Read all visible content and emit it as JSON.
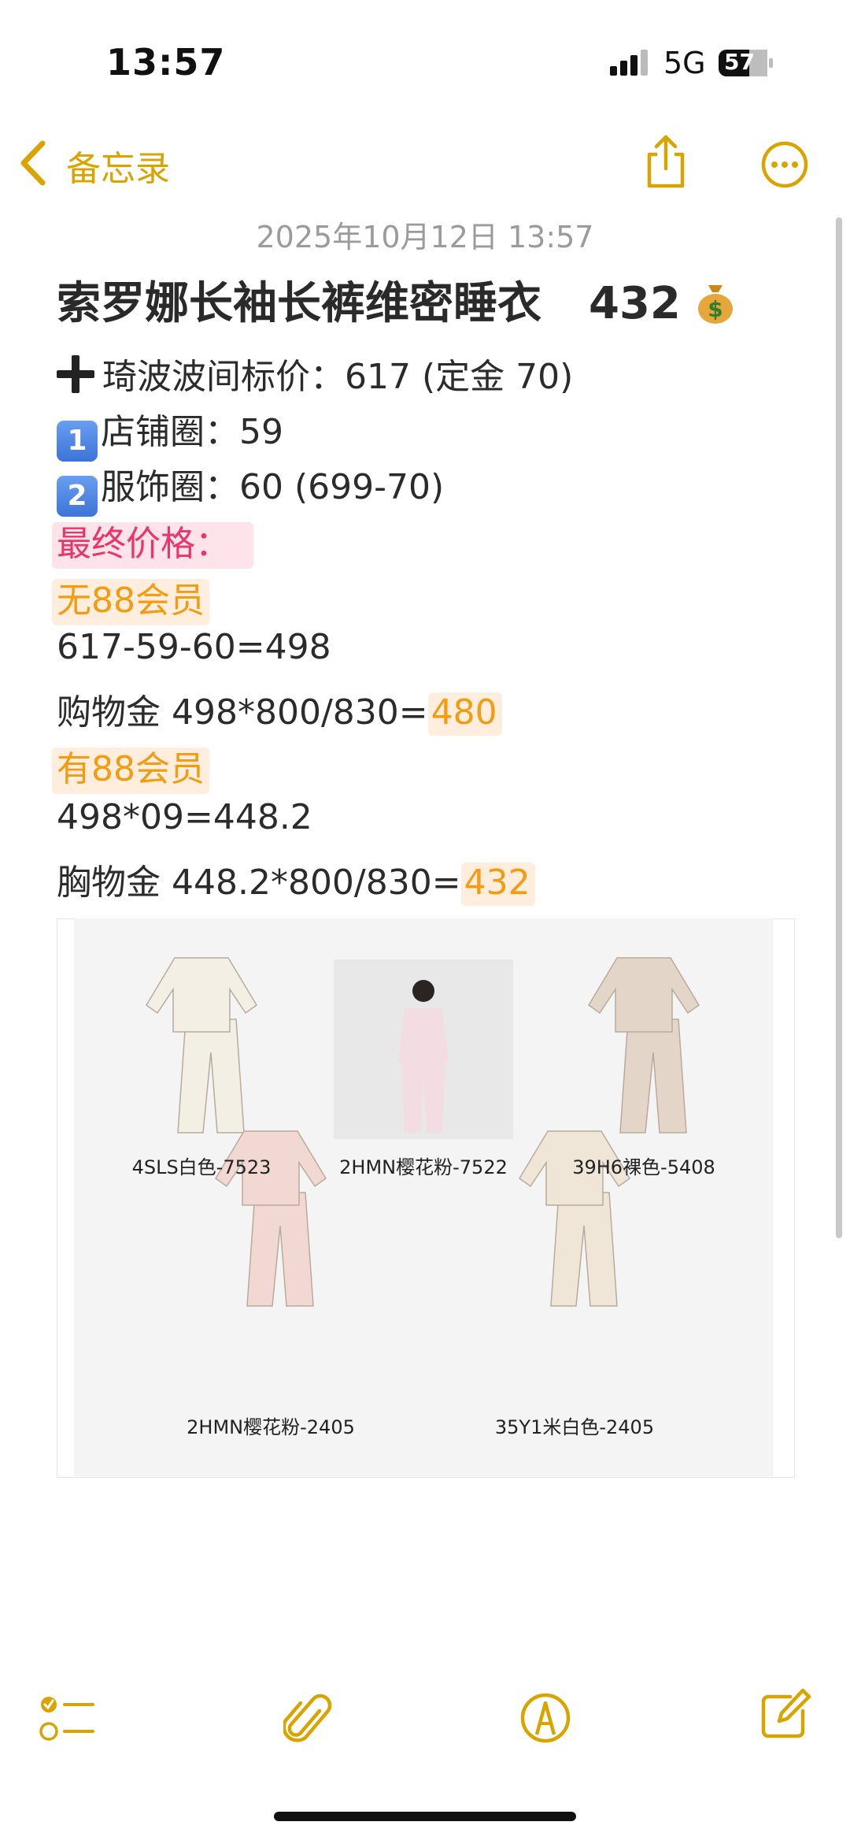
{
  "status_bar": {
    "time": "13:57",
    "network": "5G",
    "battery": "57"
  },
  "nav": {
    "back_label": "备忘录"
  },
  "note": {
    "date": "2025年10月12日 13:57",
    "title": "索罗娜长袖长裤维密睡衣",
    "title_price": "432",
    "lines": {
      "l1": "琦波波间标价：617 (定金 70)",
      "l2_badge": "1",
      "l2": "店铺圈：59",
      "l3_badge": "2",
      "l3": "服饰圈：60 (699-70)",
      "l4": "最终价格：",
      "l5": "无88会员",
      "l6": "617-59-60=498",
      "l7_prefix": "购物金 498*800/830=",
      "l7_result": "480",
      "l8": "有88会员",
      "l9": "498*09=448.2",
      "l10_prefix": "胸物金 448.2*800/830=",
      "l10_result": "432"
    },
    "products": [
      {
        "label": "4SLS白色-7523",
        "color": "#f3efe4"
      },
      {
        "label": "2HMN樱花粉-7522",
        "color": "#f2dfe2"
      },
      {
        "label": "39H6裸色-5408",
        "color": "#e3d6c8"
      },
      {
        "label": "2HMN樱花粉-2405",
        "color": "#f2d8d3"
      },
      {
        "label": "35Y1米白色-2405",
        "color": "#efe6d8"
      }
    ]
  },
  "colors": {
    "accent": "#d9a400",
    "pink": "#e8356b",
    "orange": "#f39c12"
  },
  "icons": [
    "chevron-left-icon",
    "share-icon",
    "more-icon",
    "checklist-icon",
    "attachment-icon",
    "markup-icon",
    "compose-icon",
    "money-bag-icon"
  ]
}
